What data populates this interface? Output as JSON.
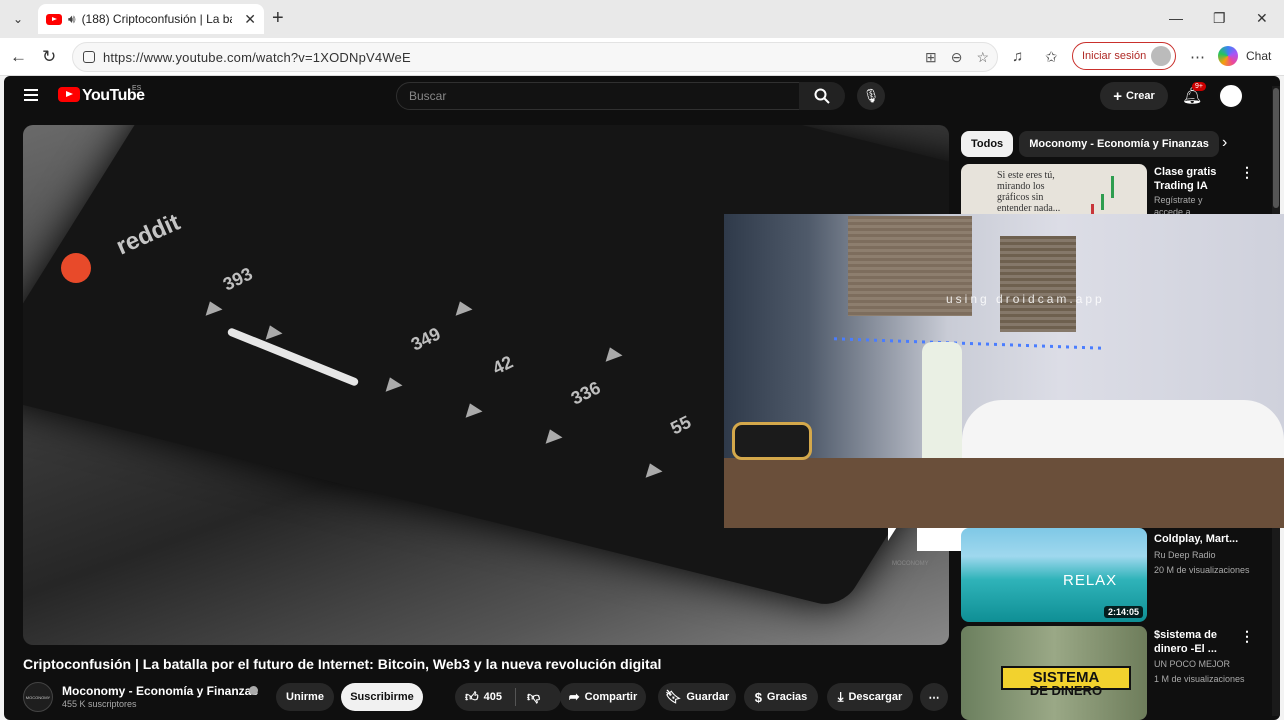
{
  "browser": {
    "tab_title": "(188) Criptoconfusión | La bata",
    "url": "https://www.youtube.com/watch?v=1XODNpV4WeE",
    "signin_label": "Iniciar sesión",
    "chat_label": "Chat"
  },
  "youtube": {
    "logo_text": "YouTube",
    "logo_country": "ES",
    "search_placeholder": "Buscar",
    "create_label": "Crear",
    "notifications_badge": "9+"
  },
  "player": {
    "reddit_word": "reddit",
    "numbers": [
      "393",
      "349",
      "42",
      "336",
      "55"
    ],
    "overlay_text": "using droidcam.app",
    "watermark_small": "MOCONOMY"
  },
  "video": {
    "title": "Criptoconfusión | La batalla por el futuro de Internet: Bitcoin, Web3 y la nueva revolución digital",
    "channel_name": "Moconomy - Economía y Finanzas",
    "channel_avatar_text": "MOCONOMY",
    "subscribers": "455 K suscriptores",
    "join_label": "Unirme",
    "subscribe_label": "Suscribirme",
    "likes": "405",
    "share_label": "Compartir",
    "save_label": "Guardar",
    "thanks_label": "Gracias",
    "download_label": "Descargar"
  },
  "chips": [
    "Todos",
    "Moconomy - Economía y Finanzas"
  ],
  "recommendations": [
    {
      "title_line1": "Clase gratis",
      "title_line2": "Trading IA",
      "meta1": "Regístrate y",
      "meta2": "accede a",
      "thumb_text": "Si este eres tú, mirando los gráficos sin entender nada..."
    },
    {
      "title_line1": "Coldplay, Mart...",
      "channel": "Ru Deep Radio",
      "views": "20 M de visualizaciones",
      "thumb_text": "RELAX",
      "duration": "2:14:05"
    },
    {
      "title_line1": "$sistema de",
      "title_line2": "dinero -El ...",
      "channel": "UN POCO MEJOR",
      "views": "1 M de visualizaciones",
      "thumb_text1": "SISTEMA",
      "thumb_text2": "DE DINERO"
    }
  ]
}
